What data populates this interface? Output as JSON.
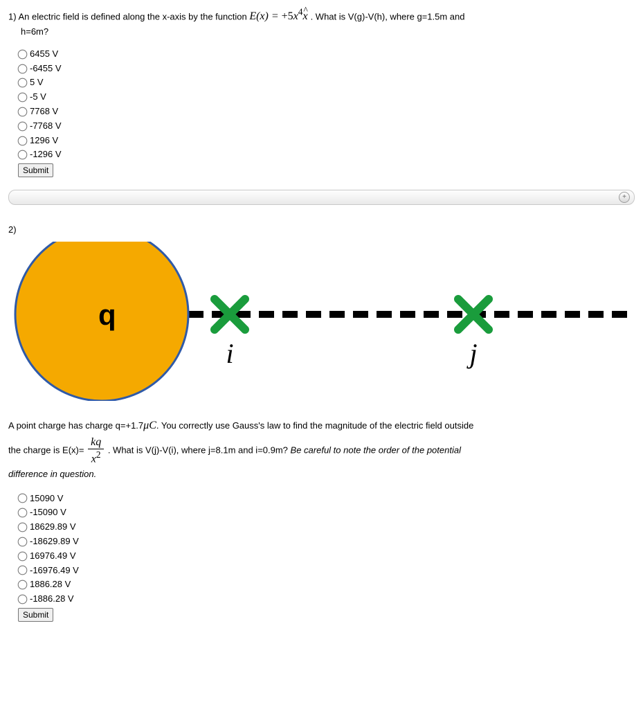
{
  "q1": {
    "number": "1)",
    "text_a": "An electric field is defined along the x-axis by the function ",
    "eq_lhs": "E(x) = ",
    "eq_rhs_coeff": "+5",
    "eq_rhs_var": "x",
    "eq_rhs_exp": "4",
    "eq_rhs_unit": "x",
    "text_b": " . What is V(g)-V(h), where g=1.5m and",
    "text_c": "h=6m?",
    "options": [
      "6455 V",
      "-6455 V",
      "5 V",
      "-5 V",
      "7768 V",
      "-7768 V",
      "1296 V",
      "-1296 V"
    ],
    "submit": "Submit"
  },
  "expand": {
    "icon": "+"
  },
  "q2": {
    "number": "2)",
    "diagram": {
      "charge_label": "q",
      "point_i": "i",
      "point_j": "j"
    },
    "text_a": "A point charge has charge q=+1.7",
    "mu": "μC",
    "text_b": ". You correctly use Gauss's law to find the magnitude of the electric field outside",
    "text_c": "the charge is E(x)=",
    "frac_num": "kq",
    "frac_den_var": "x",
    "frac_den_exp": "2",
    "text_d": " . What is V(j)-V(i), where j=8.1m and i=0.9m? ",
    "text_e": "Be careful to note the order of the potential",
    "text_f": "difference in question.",
    "options": [
      "15090 V",
      "-15090 V",
      "18629.89 V",
      "-18629.89 V",
      "16976.49 V",
      "-16976.49 V",
      "1886.28 V",
      "-1886.28 V"
    ],
    "submit": "Submit"
  }
}
